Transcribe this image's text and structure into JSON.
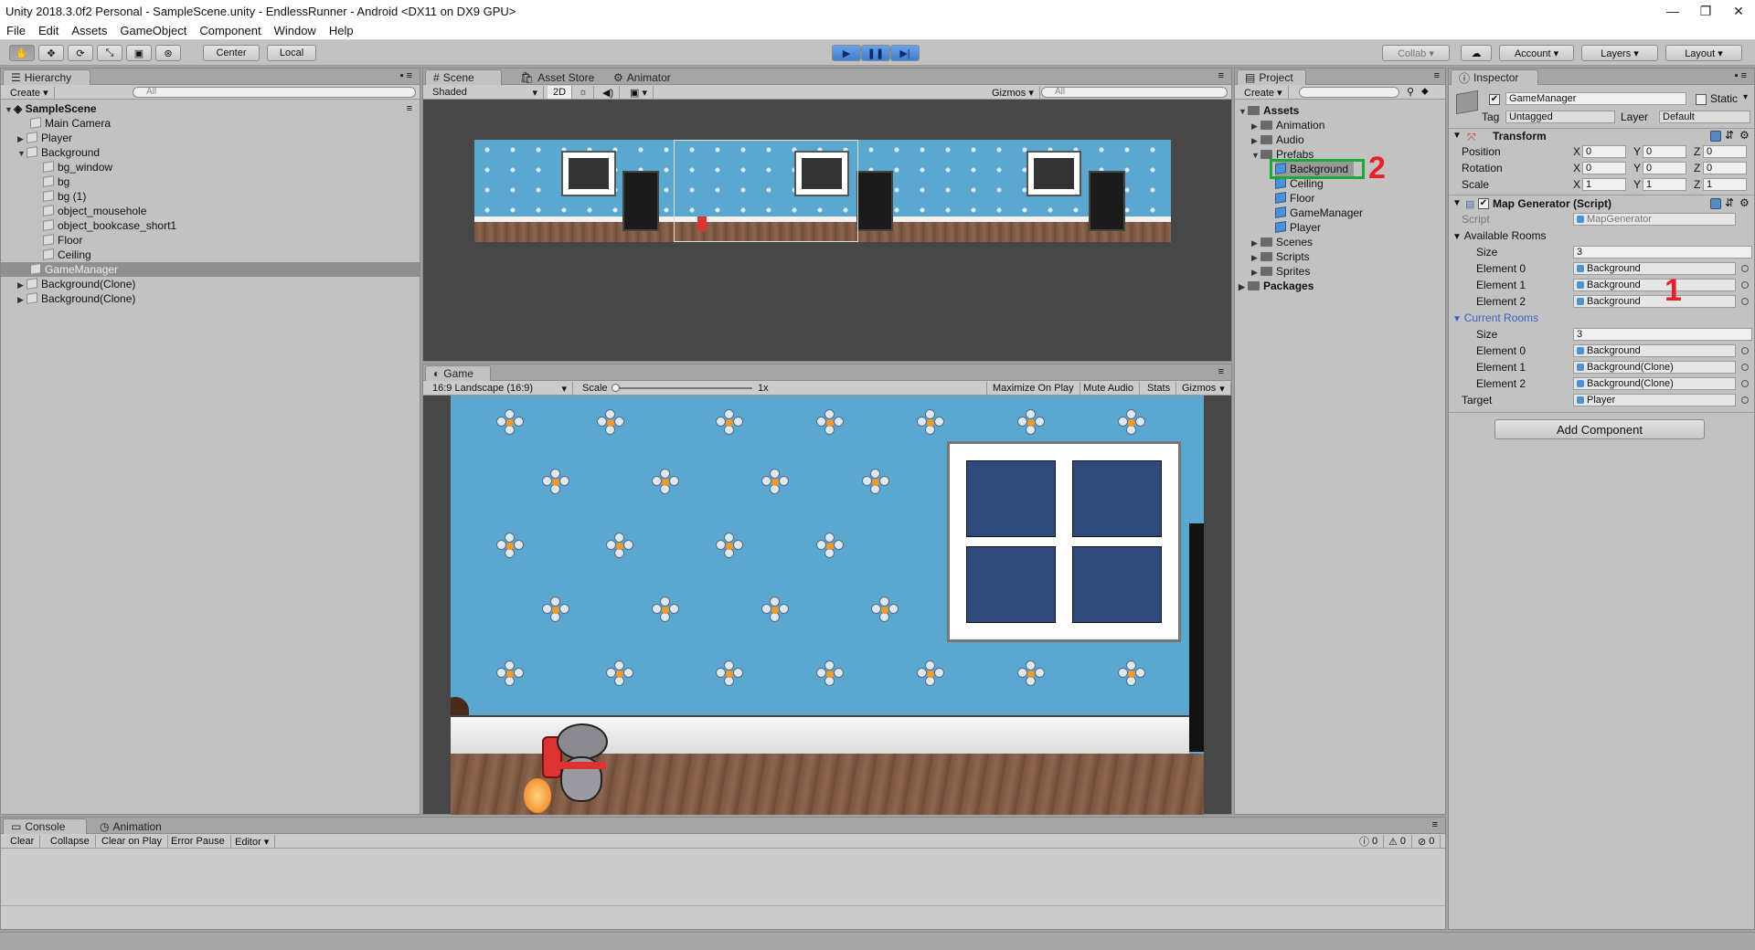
{
  "window": {
    "title": "Unity 2018.3.0f2 Personal - SampleScene.unity - EndlessRunner - Android <DX11 on DX9 GPU>",
    "min": "—",
    "max": "❐",
    "close": "✕"
  },
  "menu": [
    "File",
    "Edit",
    "Assets",
    "GameObject",
    "Component",
    "Window",
    "Help"
  ],
  "toolbar": {
    "pivot": "Center",
    "space": "Local",
    "collab": "Collab ▾",
    "account": "Account ▾",
    "layers": "Layers ▾",
    "layout": "Layout ▾",
    "play": "▶",
    "pause": "❚❚",
    "step": "▶|"
  },
  "hierarchy": {
    "tab": "Hierarchy",
    "create": "Create ▾",
    "search_placeholder": "All",
    "scene": "SampleScene",
    "items": [
      "Main Camera",
      "Player",
      "Background",
      "bg_window",
      "bg",
      "bg (1)",
      "object_mousehole",
      "object_bookcase_short1",
      "Floor",
      "Ceiling",
      "GameManager",
      "Background(Clone)",
      "Background(Clone)"
    ]
  },
  "scene_view": {
    "tabs": [
      "Scene",
      "Asset Store",
      "Animator"
    ],
    "shading": "Shaded",
    "mode2d": "2D",
    "gizmos": "Gizmos ▾",
    "search_placeholder": "All"
  },
  "game_view": {
    "tab": "Game",
    "aspect": "16:9 Landscape (16:9)",
    "scale_label": "Scale",
    "scale_value": "1x",
    "buttons": [
      "Maximize On Play",
      "Mute Audio",
      "Stats",
      "Gizmos"
    ]
  },
  "project": {
    "tab": "Project",
    "create": "Create ▾",
    "assets": "Assets",
    "folders": [
      "Animation",
      "Audio",
      "Prefabs"
    ],
    "prefabs": [
      "Background",
      "Ceiling",
      "Floor",
      "GameManager",
      "Player"
    ],
    "more_folders": [
      "Scenes",
      "Scripts",
      "Sprites"
    ],
    "packages": "Packages"
  },
  "inspector": {
    "tab": "Inspector",
    "object_name": "GameManager",
    "static": "Static",
    "tag_label": "Tag",
    "tag": "Untagged",
    "layer_label": "Layer",
    "layer": "Default",
    "transform": {
      "title": "Transform",
      "rows": [
        {
          "label": "Position",
          "x": "0",
          "y": "0",
          "z": "0"
        },
        {
          "label": "Rotation",
          "x": "0",
          "y": "0",
          "z": "0"
        },
        {
          "label": "Scale",
          "x": "1",
          "y": "1",
          "z": "1"
        }
      ]
    },
    "map_generator": {
      "title": "Map Generator (Script)",
      "script_label": "Script",
      "script": "MapGenerator",
      "available_label": "Available Rooms",
      "size_label": "Size",
      "available_size": "3",
      "available": [
        {
          "label": "Element 0",
          "value": "Background"
        },
        {
          "label": "Element 1",
          "value": "Background"
        },
        {
          "label": "Element 2",
          "value": "Background"
        }
      ],
      "current_label": "Current Rooms",
      "current_size": "3",
      "current": [
        {
          "label": "Element 0",
          "value": "Background"
        },
        {
          "label": "Element 1",
          "value": "Background(Clone)"
        },
        {
          "label": "Element 2",
          "value": "Background(Clone)"
        }
      ],
      "target_label": "Target",
      "target": "Player"
    },
    "add_component": "Add Component"
  },
  "console": {
    "tabs": [
      "Console",
      "Animation"
    ],
    "buttons": [
      "Clear",
      "Collapse",
      "Clear on Play",
      "Error Pause",
      "Editor ▾"
    ],
    "counts": [
      "0",
      "0",
      "0"
    ]
  },
  "annotations": {
    "one": "1",
    "two": "2",
    "one_color": "#e8202a",
    "two_color": "#e8202a",
    "box_color": "#1fa83a"
  },
  "colors": {
    "wallpaper": "#5aa7d0",
    "floor": "#7a5540",
    "window_glass": "#2e4a7a"
  }
}
